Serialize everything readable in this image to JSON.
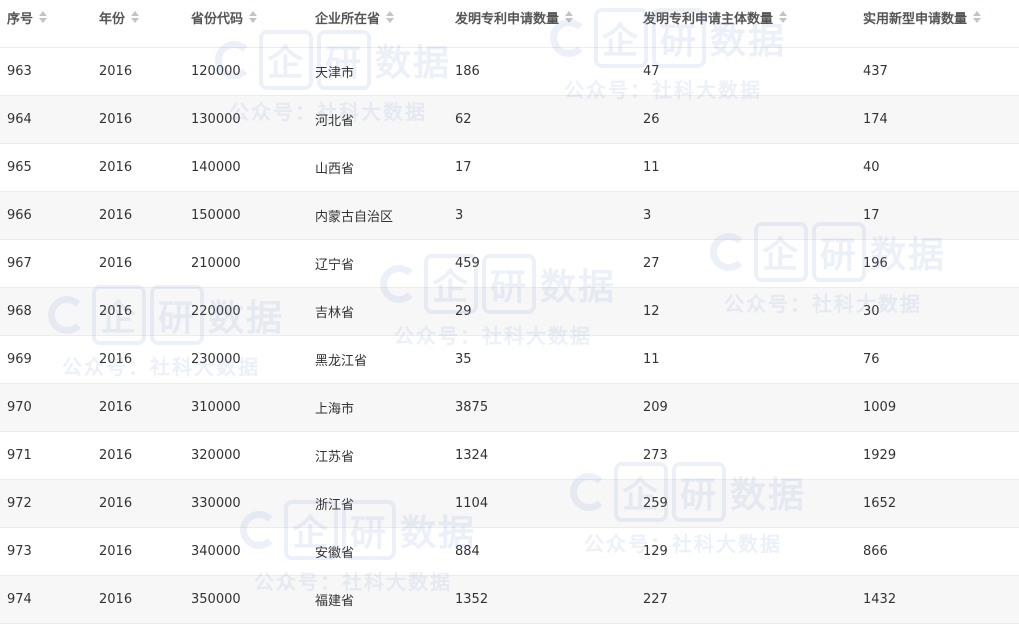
{
  "columns": [
    "序号",
    "年份",
    "省份代码",
    "企业所在省",
    "发明专利申请数量",
    "发明专利申请主体数量",
    "实用新型申请数量"
  ],
  "rows": [
    [
      "963",
      "2016",
      "120000",
      "天津市",
      "186",
      "47",
      "437"
    ],
    [
      "964",
      "2016",
      "130000",
      "河北省",
      "62",
      "26",
      "174"
    ],
    [
      "965",
      "2016",
      "140000",
      "山西省",
      "17",
      "11",
      "40"
    ],
    [
      "966",
      "2016",
      "150000",
      "内蒙古自治区",
      "3",
      "3",
      "17"
    ],
    [
      "967",
      "2016",
      "210000",
      "辽宁省",
      "459",
      "27",
      "196"
    ],
    [
      "968",
      "2016",
      "220000",
      "吉林省",
      "29",
      "12",
      "30"
    ],
    [
      "969",
      "2016",
      "230000",
      "黑龙江省",
      "35",
      "11",
      "76"
    ],
    [
      "970",
      "2016",
      "310000",
      "上海市",
      "3875",
      "209",
      "1009"
    ],
    [
      "971",
      "2016",
      "320000",
      "江苏省",
      "1324",
      "273",
      "1929"
    ],
    [
      "972",
      "2016",
      "330000",
      "浙江省",
      "1104",
      "259",
      "1652"
    ],
    [
      "973",
      "2016",
      "340000",
      "安徽省",
      "884",
      "129",
      "866"
    ],
    [
      "974",
      "2016",
      "350000",
      "福建省",
      "1352",
      "227",
      "1432"
    ]
  ],
  "watermark": {
    "brand_a": "企",
    "brand_b": "研",
    "brand_c": "数据",
    "subtitle": "公众号：社科大数据"
  }
}
